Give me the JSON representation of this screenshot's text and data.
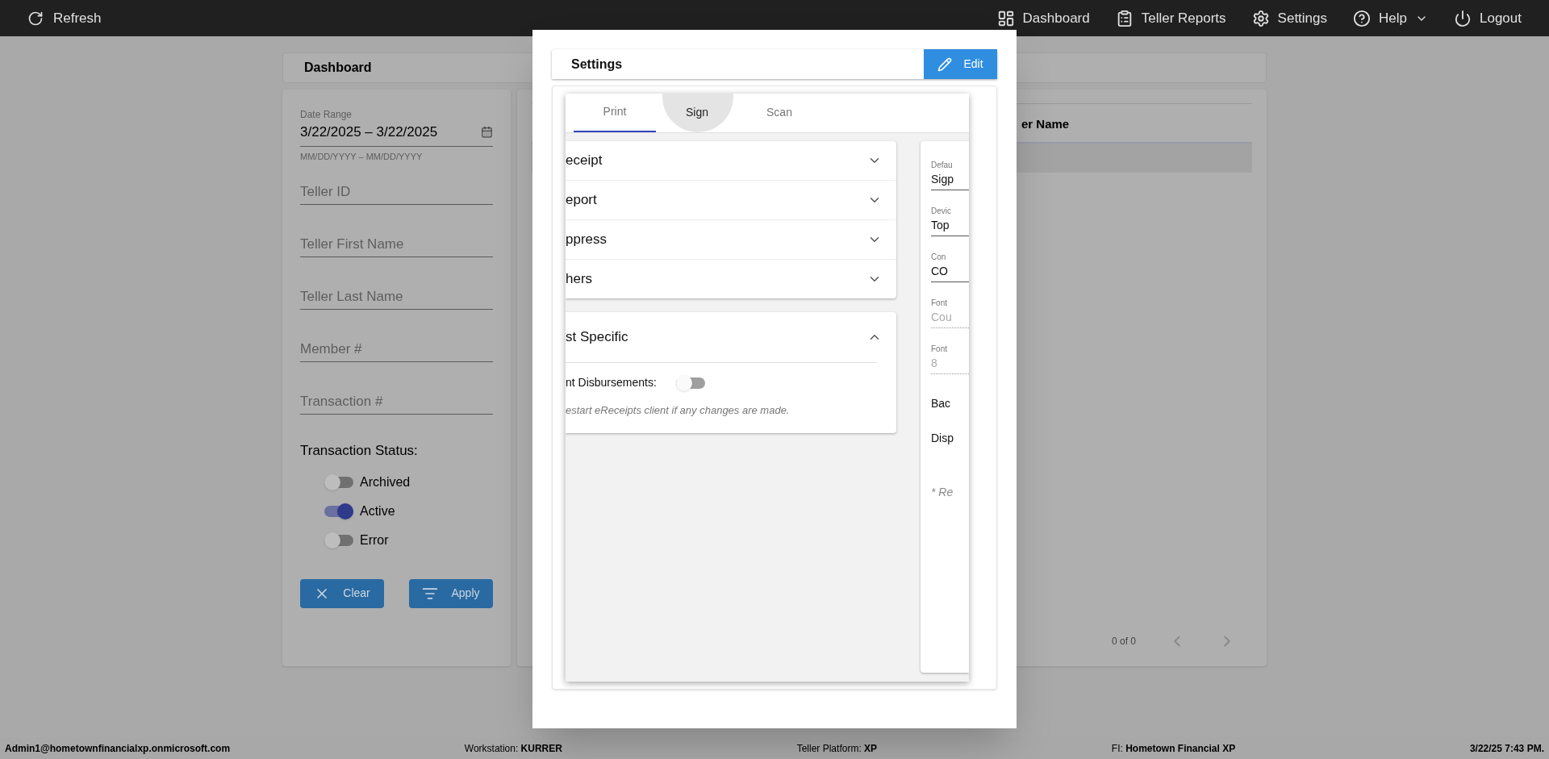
{
  "top_bar": {
    "refresh": "Refresh",
    "nav": [
      {
        "label": "Dashboard",
        "dropdown": false
      },
      {
        "label": "Teller Reports",
        "dropdown": false
      },
      {
        "label": "Settings",
        "dropdown": false
      },
      {
        "label": "Help",
        "dropdown": true
      },
      {
        "label": "Logout",
        "dropdown": false
      }
    ]
  },
  "dashboard": {
    "title": "Dashboard",
    "filters": {
      "date_range": {
        "label": "Date Range",
        "value": "3/22/2025 – 3/22/2025",
        "helper": "MM/DD/YYYY – MM/DD/YYYY"
      },
      "fields": [
        {
          "placeholder": "Teller ID"
        },
        {
          "placeholder": "Teller First Name"
        },
        {
          "placeholder": "Teller Last Name"
        },
        {
          "placeholder": "Member #"
        },
        {
          "placeholder": "Transaction #"
        }
      ],
      "status_label": "Transaction Status:",
      "statuses": [
        {
          "label": "Archived",
          "on": false
        },
        {
          "label": "Active",
          "on": true
        },
        {
          "label": "Error",
          "on": false
        }
      ],
      "buttons": [
        {
          "label": "Clear"
        },
        {
          "label": "Apply"
        }
      ]
    },
    "table": {
      "column_header": "er Name",
      "pagination": "0 of 0"
    }
  },
  "modal": {
    "title": "Settings",
    "edit_button": "Edit",
    "tabs": [
      {
        "label": "Print",
        "selected": true,
        "highlighted": false
      },
      {
        "label": "Sign",
        "selected": false,
        "highlighted": true
      },
      {
        "label": "Scan",
        "selected": false,
        "highlighted": false
      }
    ],
    "accordion_cards": [
      {
        "sections": [
          {
            "title": "eceipt",
            "expanded": false
          },
          {
            "title": "eport",
            "expanded": false
          },
          {
            "title": "ppress",
            "expanded": false
          },
          {
            "title": "hers",
            "expanded": false
          }
        ]
      },
      {
        "sections": [
          {
            "title": "st Specific",
            "expanded": true,
            "toggles": [
              {
                "label": "nt Disbursements:",
                "on": false
              }
            ],
            "note": "estart eReceipts client if any changes are made."
          }
        ]
      }
    ],
    "device_fields": [
      {
        "label": "Defau",
        "value": "Sigp",
        "disabled": false
      },
      {
        "label": "Devic",
        "value": "Top",
        "disabled": false
      },
      {
        "label": "Con",
        "value": "CO",
        "disabled": false
      },
      {
        "label": "Font",
        "value": "Cou",
        "disabled": true
      },
      {
        "label": "Font",
        "value": "8",
        "disabled": true
      }
    ],
    "options": [
      "Bac",
      "Disp"
    ],
    "device_note": "* Re"
  },
  "status_bar": [
    {
      "value": "Admin1@hometownfinancialxp.onmicrosoft.com"
    },
    {
      "label": "Workstation:",
      "value": "KURRER"
    },
    {
      "label": "Teller Platform:",
      "value": "XP"
    },
    {
      "label": "FI:",
      "value": "Hometown Financial XP"
    },
    {
      "value": "3/22/25 7:43 PM."
    }
  ]
}
